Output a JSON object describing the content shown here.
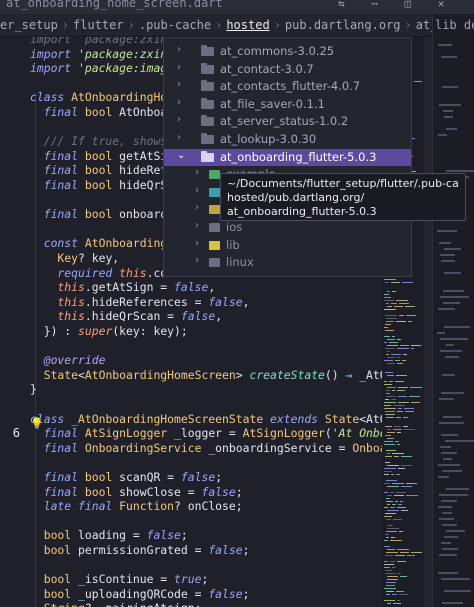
{
  "window": {
    "tab_title": "at_onboarding_home_screen.dart",
    "tab_icons": [
      "diff-icon",
      "dots-icon",
      "split-icon",
      "close-icon"
    ]
  },
  "breadcrumbs": [
    {
      "label": "er_setup",
      "active": false
    },
    {
      "label": "flutter",
      "active": false
    },
    {
      "label": ".pub-cache",
      "active": false
    },
    {
      "label": "hosted",
      "active": true
    },
    {
      "label": "pub.dartlang.org",
      "active": false
    },
    {
      "label": "at_onboarding_flutter-5.0",
      "active": false
    }
  ],
  "right_pane": {
    "top_label": "lib  de"
  },
  "dropdown": {
    "items": [
      {
        "label": "at_commons-3.0.25",
        "expanded": false,
        "selected": false
      },
      {
        "label": "at_contact-3.0.7",
        "expanded": false,
        "selected": false
      },
      {
        "label": "at_contacts_flutter-4.0.7",
        "expanded": false,
        "selected": false
      },
      {
        "label": "at_file_saver-0.1.1",
        "expanded": false,
        "selected": false
      },
      {
        "label": "at_server_status-1.0.2",
        "expanded": false,
        "selected": false
      },
      {
        "label": "at_lookup-3.0.30",
        "expanded": false,
        "selected": false
      },
      {
        "label": "at_onboarding_flutter-5.0.3",
        "expanded": true,
        "selected": true
      }
    ],
    "children": [
      {
        "label": "example",
        "color": "#4ea665"
      },
      {
        "label": "lib",
        "color": "#3f9db0"
      },
      {
        "label": "assets",
        "color": "#c0a640"
      },
      {
        "label": "ios",
        "color": "#6b6f81"
      },
      {
        "label": "lib",
        "color": "#d6c43a"
      },
      {
        "label": "linux",
        "color": "#6b6f81"
      }
    ]
  },
  "tooltip": {
    "lines": [
      "~/Documents/flutter_setup/flutter/.pub-cache/",
      "hosted/pub.dartlang.org/",
      "at_onboarding_flutter-5.0.3"
    ]
  },
  "editor": {
    "active_line_number": "6",
    "lines": [
      [
        [
          "import 'package:zxing2/...",
          "cm"
        ]
      ],
      [
        [
          "import ",
          "kw"
        ],
        [
          "'package:zxing2/",
          "str"
        ]
      ],
      [
        [
          "import ",
          "kw"
        ],
        [
          "'package:image/i",
          "str"
        ]
      ],
      [
        [
          "",
          "vr"
        ]
      ],
      [
        [
          "class ",
          "kw"
        ],
        [
          "AtOnboardingHomeS",
          "ty"
        ]
      ],
      [
        [
          "  final ",
          "kw"
        ],
        [
          "bool ",
          "ty"
        ],
        [
          "AtOnboardingCon",
          "vr"
        ]
      ],
      [
        [
          "",
          "vr"
        ]
      ],
      [
        [
          "  /// If true, shows th",
          "cm"
        ]
      ],
      [
        [
          "  final ",
          "kw"
        ],
        [
          "bool ",
          "ty"
        ],
        [
          "getAtSign;",
          "vr"
        ]
      ],
      [
        [
          "  final ",
          "kw"
        ],
        [
          "bool ",
          "ty"
        ],
        [
          "hideRefere",
          "vr"
        ]
      ],
      [
        [
          "  final ",
          "kw"
        ],
        [
          "bool ",
          "ty"
        ],
        [
          "hideQrScan",
          "vr"
        ]
      ],
      [
        [
          "",
          "vr"
        ]
      ],
      [
        [
          "  final ",
          "kw"
        ],
        [
          "bool ",
          "ty"
        ],
        [
          "onboardStatus = ",
          "vr"
        ]
      ],
      [
        [
          "",
          "vr"
        ]
      ],
      [
        [
          "  const ",
          "kw"
        ],
        [
          "AtOnboardingHome",
          "ty"
        ]
      ],
      [
        [
          "    Key",
          "ty"
        ],
        [
          "? key,",
          "vr"
        ]
      ],
      [
        [
          "    required ",
          "kw"
        ],
        [
          "this",
          "pk"
        ],
        [
          ".confi",
          "vr"
        ]
      ],
      [
        [
          "    this",
          "pk"
        ],
        [
          ".getAtSign = ",
          "vr"
        ],
        [
          "false",
          "kw"
        ],
        [
          ",",
          "vr"
        ]
      ],
      [
        [
          "    this",
          "pk"
        ],
        [
          ".hideReferences = ",
          "vr"
        ],
        [
          "false",
          "kw"
        ],
        [
          ",",
          "vr"
        ]
      ],
      [
        [
          "    this",
          "pk"
        ],
        [
          ".hideQrScan = ",
          "vr"
        ],
        [
          "false",
          "kw"
        ],
        [
          ",",
          "vr"
        ]
      ],
      [
        [
          "  }) : ",
          "vr"
        ],
        [
          "super",
          "pk"
        ],
        [
          "(key: key);",
          "vr"
        ]
      ],
      [
        [
          "",
          "vr"
        ]
      ],
      [
        [
          "  @override",
          "an"
        ]
      ],
      [
        [
          "  State",
          "ty"
        ],
        [
          "<",
          "vr"
        ],
        [
          "AtOnboardingHomeScreen",
          "ty"
        ],
        [
          "> ",
          "vr"
        ],
        [
          "createState",
          "fn"
        ],
        [
          "() ",
          "vr"
        ],
        [
          "⇒ ",
          "op"
        ],
        [
          "_AtOnboard",
          "vr"
        ]
      ],
      [
        [
          "}",
          "vr"
        ]
      ],
      [
        [
          "",
          "vr"
        ]
      ],
      [
        [
          "class ",
          "kw"
        ],
        [
          "_AtOnboardingHomeScreenState ",
          "ty"
        ],
        [
          "extends ",
          "kw"
        ],
        [
          "State",
          "ty"
        ],
        [
          "<AtOnboardi",
          "vr"
        ]
      ],
      [
        [
          "  final ",
          "kw"
        ],
        [
          "AtSignLogger ",
          "ty"
        ],
        [
          "_logger = ",
          "vr"
        ],
        [
          "AtSignLogger",
          "ty"
        ],
        [
          "(",
          "vr"
        ],
        [
          "'At Onboarding'",
          "str"
        ]
      ],
      [
        [
          "  final ",
          "kw"
        ],
        [
          "OnboardingService ",
          "ty"
        ],
        [
          "_onboardingService = ",
          "vr"
        ],
        [
          "OnboardingSe",
          "ty"
        ]
      ],
      [
        [
          "",
          "vr"
        ]
      ],
      [
        [
          "  final ",
          "kw"
        ],
        [
          "bool ",
          "ty"
        ],
        [
          "scanQR = ",
          "vr"
        ],
        [
          "false",
          "kw"
        ],
        [
          ";",
          "vr"
        ]
      ],
      [
        [
          "  final ",
          "kw"
        ],
        [
          "bool ",
          "ty"
        ],
        [
          "showClose = ",
          "vr"
        ],
        [
          "false",
          "kw"
        ],
        [
          ";",
          "vr"
        ]
      ],
      [
        [
          "  late final ",
          "kw"
        ],
        [
          "Function",
          "ty"
        ],
        [
          "? onClose;",
          "vr"
        ]
      ],
      [
        [
          "",
          "vr"
        ]
      ],
      [
        [
          "  bool ",
          "ty"
        ],
        [
          "loading = ",
          "vr"
        ],
        [
          "false",
          "kw"
        ],
        [
          ";",
          "vr"
        ]
      ],
      [
        [
          "  bool ",
          "ty"
        ],
        [
          "permissionGrated = ",
          "vr"
        ],
        [
          "false",
          "kw"
        ],
        [
          ";",
          "vr"
        ]
      ],
      [
        [
          "",
          "vr"
        ]
      ],
      [
        [
          "  bool ",
          "ty"
        ],
        [
          "_isContinue = ",
          "vr"
        ],
        [
          "true",
          "kw"
        ],
        [
          ";",
          "vr"
        ]
      ],
      [
        [
          "  bool ",
          "ty"
        ],
        [
          "_uploadingQRCode = ",
          "vr"
        ],
        [
          "false",
          "kw"
        ],
        [
          ";",
          "vr"
        ]
      ],
      [
        [
          "  String",
          "ty"
        ],
        [
          "? _pairingAtsign;",
          "vr"
        ]
      ]
    ]
  },
  "colors": {
    "background": "#1f2029",
    "selection": "#5b4a9e",
    "keyword": "#9aa7ff",
    "type": "#f2c97d",
    "string": "#c3e88d"
  }
}
